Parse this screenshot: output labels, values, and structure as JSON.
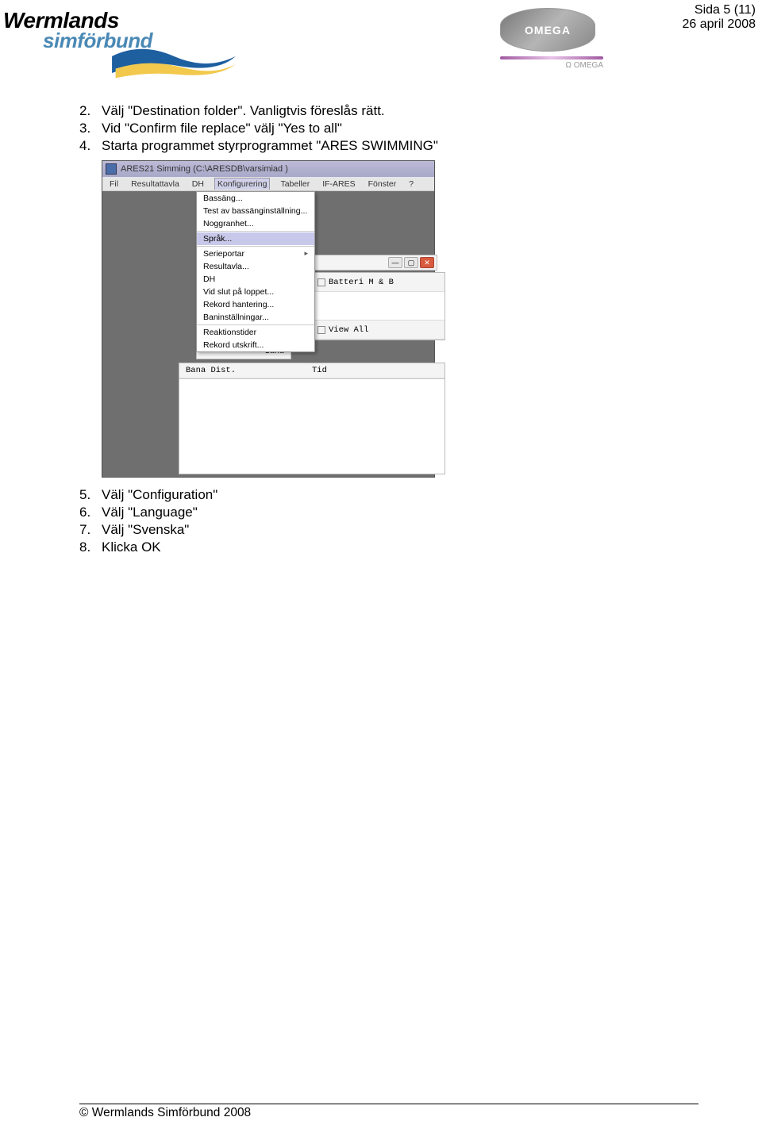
{
  "header": {
    "brand_top": "Wermlands",
    "brand_bottom": "simförbund",
    "omega_label": "OMEGA",
    "omega_sublabel": "Ω OMEGA"
  },
  "page_meta": {
    "page_label": "Sida 5 (11)",
    "date": "26 april 2008"
  },
  "steps": {
    "s2": "Välj \"Destination folder\". Vanligtvis föreslås rätt.",
    "s3": "Vid \"Confirm file replace\" välj \"Yes to all\"",
    "s4": "Starta programmet styrprogrammet \"ARES SWIMMING\"",
    "s5": "Välj \"Configuration\"",
    "s6": "Välj \"Language\"",
    "s7": "Välj \"Svenska\"",
    "s8": "Klicka OK"
  },
  "screenshot": {
    "title": "ARES21 Simming (C:\\ARESDB\\varsimiad )",
    "menubar": {
      "m0": "Fil",
      "m1": "Resultattavla",
      "m2": "DH",
      "m3": "Konfigurering",
      "m4": "Tabeller",
      "m5": "IF-ARES",
      "m6": "Fönster",
      "m7": "?"
    },
    "dropdown": {
      "i0": "Bassäng...",
      "i1": "Test av bassänginställning...",
      "i2": "Noggranhet...",
      "i3": "Språk...",
      "i4": "Serieportar",
      "i5": "Resultavla...",
      "i6": "DH",
      "i7": "Vid slut på loppet...",
      "i8": "Rekord hantering...",
      "i9": "Baninställningar...",
      "i10": "Reaktionstider",
      "i11": "Rekord utskrift..."
    },
    "panel": {
      "batteri": "Batteri M & B",
      "viewall": "View All",
      "bana": "Bana",
      "bana_dist": "Bana Dist.",
      "tid": "Tid"
    }
  },
  "footer": "© Wermlands Simförbund 2008"
}
